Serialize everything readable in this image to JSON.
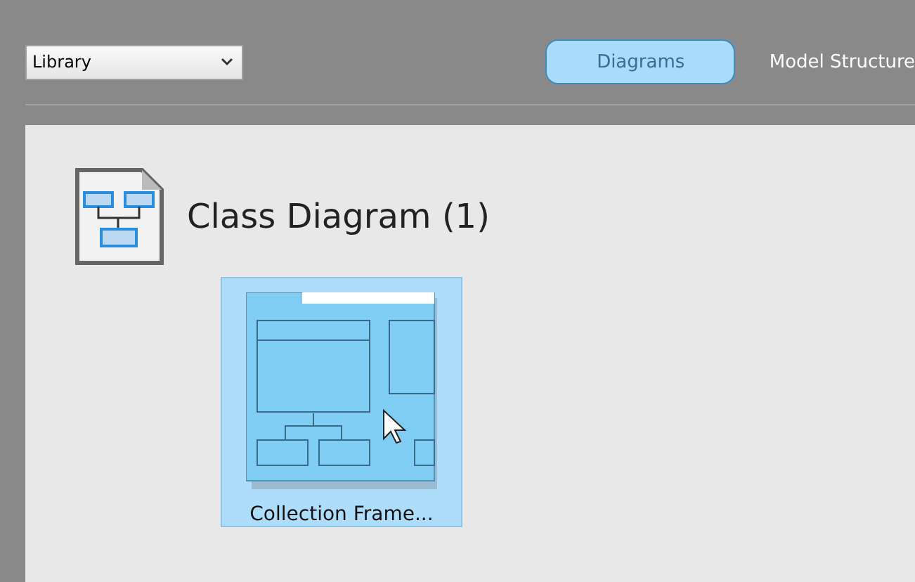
{
  "toolbar": {
    "dropdown": {
      "value": "Library"
    },
    "tabs": [
      {
        "label": "Diagrams",
        "selected": true
      },
      {
        "label": "Model Structure",
        "selected": false
      }
    ]
  },
  "sections": [
    {
      "title": "Class Diagram (1)",
      "items": [
        {
          "label": "Collection Frame...",
          "selected": true
        }
      ]
    }
  ]
}
